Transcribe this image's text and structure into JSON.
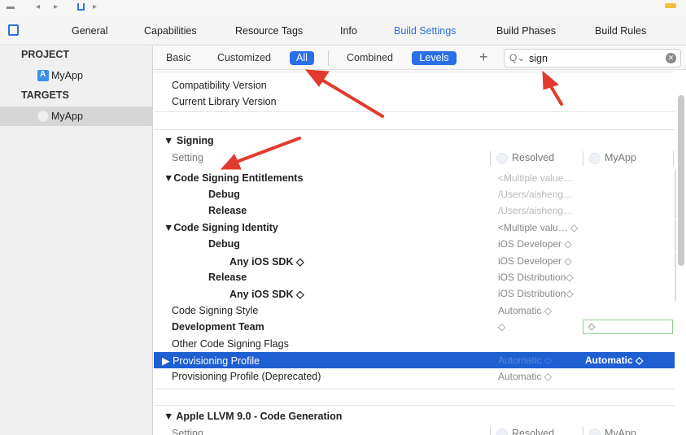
{
  "tabs": [
    {
      "label": "General",
      "active": false
    },
    {
      "label": "Capabilities",
      "active": false
    },
    {
      "label": "Resource Tags",
      "active": false
    },
    {
      "label": "Info",
      "active": false
    },
    {
      "label": "Build Settings",
      "active": true
    },
    {
      "label": "Build Phases",
      "active": false
    },
    {
      "label": "Build Rules",
      "active": false
    }
  ],
  "sidebar": {
    "project_header": "PROJECT",
    "project_item": "MyApp",
    "targets_header": "TARGETS",
    "target_item": "MyApp"
  },
  "filter": {
    "basic": "Basic",
    "customized": "Customized",
    "all": "All",
    "combined": "Combined",
    "levels": "Levels",
    "add": "+",
    "search_icon": "search-icon",
    "search_value": "sign"
  },
  "settings": {
    "compat_version": "Compatibility Version",
    "current_lib_version": "Current Library Version",
    "signing_section": "Signing",
    "setting_col": "Setting",
    "resolved_col": "Resolved",
    "target_col": "MyApp",
    "cse": {
      "label": "Code Signing Entitlements",
      "value": "<Multiple value…",
      "debug": "Debug",
      "debug_value": "/Users/aisheng…",
      "release": "Release",
      "release_value": "/Users/aisheng…"
    },
    "csi": {
      "label": "Code Signing Identity",
      "value": "<Multiple valu… ◇",
      "debug": "Debug",
      "debug_value": "iOS Developer ◇",
      "any_sdk_debug": "Any iOS SDK ◇",
      "any_sdk_debug_value": "iOS Developer ◇",
      "release": "Release",
      "release_value": "iOS Distribution◇",
      "any_sdk_release": "Any iOS SDK ◇",
      "any_sdk_release_value": "iOS Distribution◇"
    },
    "cs_style": {
      "label": "Code Signing Style",
      "value": "Automatic ◇"
    },
    "dev_team": {
      "label": "Development Team",
      "value": "◇",
      "target_value": "◇"
    },
    "other_flags": {
      "label": "Other Code Signing Flags"
    },
    "prov_profile": {
      "label": "▶ Provisioning Profile",
      "value": "Automatic ◇",
      "target_value": "Automatic ◇"
    },
    "prov_profile_dep": {
      "label": "Provisioning Profile (Deprecated)",
      "value": "Automatic ◇"
    },
    "llvm_section": "Apple LLVM 9.0 - Code Generation",
    "llvm_setting_col": "Setting",
    "llvm_resolved_col": "Resolved",
    "llvm_target_col": "MyApp"
  },
  "colors": {
    "accent": "#2a6ee8",
    "selection": "#1e5fd2",
    "annotation_arrow": "#e23b2e"
  }
}
